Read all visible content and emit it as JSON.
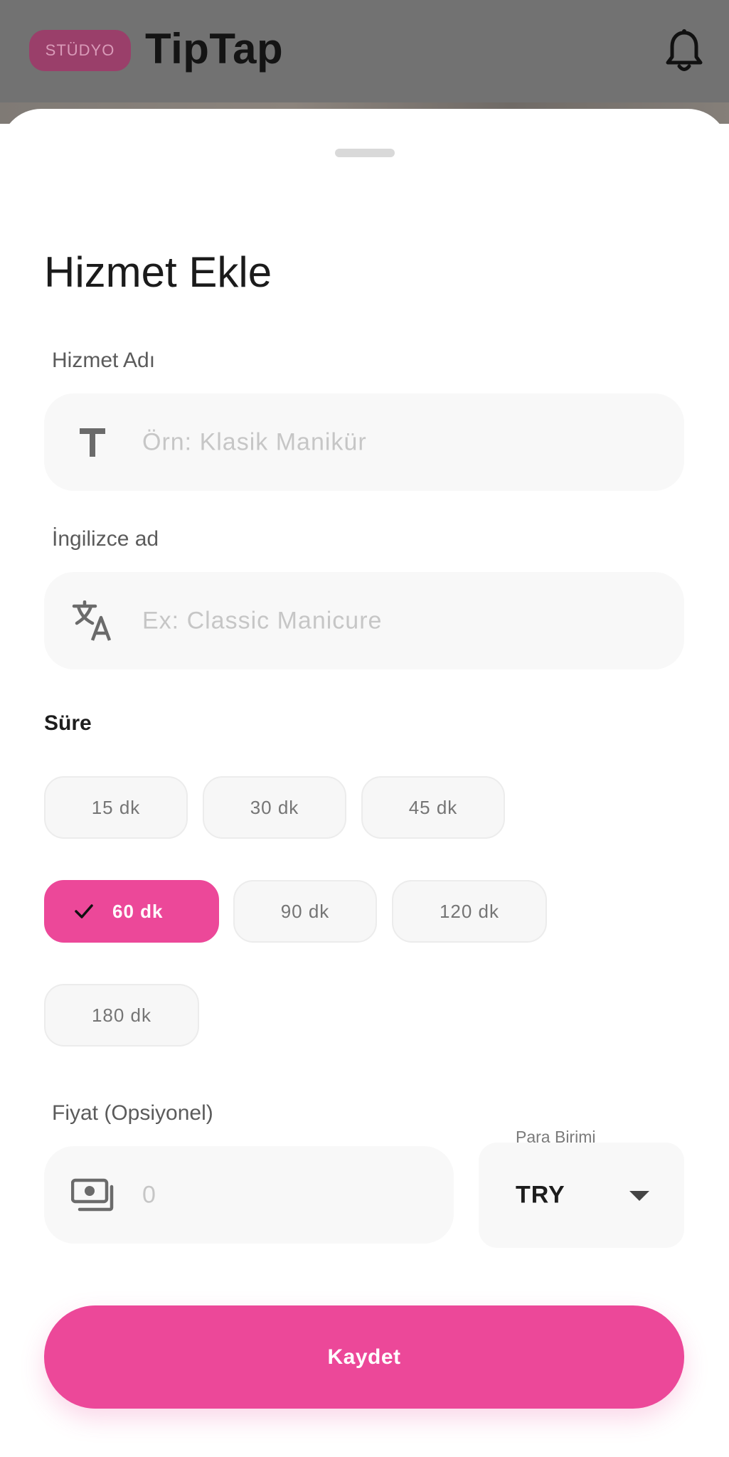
{
  "header": {
    "badge": "STÜDYO",
    "title": "TipTap",
    "bell_icon": "bell-icon"
  },
  "sheet": {
    "title": "Hizmet Ekle",
    "service_name": {
      "label": "Hizmet Adı",
      "placeholder": "Örn: Klasik Manikür",
      "icon": "text-t-icon"
    },
    "english_name": {
      "label": "İngilizce ad",
      "placeholder": "Ex: Classic Manicure",
      "icon": "translate-icon"
    },
    "duration": {
      "title": "Süre",
      "options": [
        "15 dk",
        "30 dk",
        "45 dk",
        "60 dk",
        "90 dk",
        "120 dk",
        "180 dk"
      ],
      "selected": "60 dk"
    },
    "price": {
      "label": "Fiyat (Opsiyonel)",
      "placeholder": "0",
      "icon": "money-icon"
    },
    "currency": {
      "label": "Para Birimi",
      "value": "TRY"
    },
    "save_label": "Kaydet"
  },
  "colors": {
    "accent": "#ec4899",
    "overlay_header": "#727272",
    "field_background": "#f8f8f8"
  }
}
